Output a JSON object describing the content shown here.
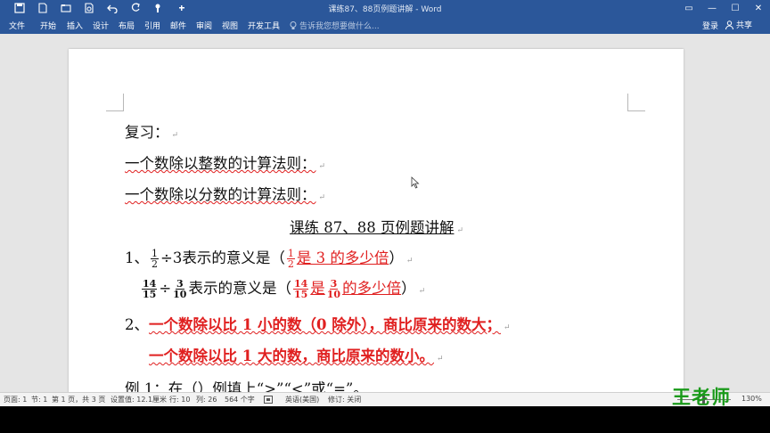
{
  "window": {
    "title": "课练87、88页例题讲解 - Word",
    "controls": {
      "restore": "▭",
      "minimize": "—",
      "maximize": "☐",
      "close": "✕"
    }
  },
  "quick_access": [
    {
      "icon": "save-icon"
    },
    {
      "icon": "new-document-icon"
    },
    {
      "icon": "open-icon"
    },
    {
      "icon": "print-preview-icon"
    },
    {
      "icon": "undo-icon"
    },
    {
      "icon": "redo-icon"
    },
    {
      "icon": "touch-mode-icon"
    },
    {
      "icon": "customize-icon"
    }
  ],
  "ribbon_tabs": [
    "文件",
    "开始",
    "插入",
    "设计",
    "布局",
    "引用",
    "邮件",
    "审阅",
    "视图",
    "开发工具"
  ],
  "tell_me": {
    "placeholder": "告诉我您想要做什么..."
  },
  "account": {
    "signin": "登录",
    "share": "共享"
  },
  "document": {
    "review_heading": "复习：",
    "rule_integer": "一个数除以整数的计算法则：",
    "rule_fraction": "一个数除以分数的计算法则：",
    "section_title": "课练 87、88 页例题讲解",
    "q1": {
      "number": "1、",
      "frac_a": {
        "num": "1",
        "den": "2"
      },
      "divide_by": "÷3",
      "meaning_label": "表示的意义是（",
      "ans_frac": {
        "num": "1",
        "den": "2"
      },
      "answer": "是 3 的多少倍",
      "close": "）"
    },
    "q1b": {
      "frac_a": {
        "num": "14",
        "den": "15"
      },
      "divide": "÷",
      "frac_b": {
        "num": "3",
        "den": "10"
      },
      "meaning_label": "表示的意义是（",
      "ans_frac_a": {
        "num": "14",
        "den": "15"
      },
      "answer_mid": "是",
      "ans_frac_b": {
        "num": "3",
        "den": "10"
      },
      "answer_end": "的多少倍",
      "close": "）"
    },
    "q2": {
      "number": "2、",
      "line1": "一个数除以比 1 小的数（0 除外），商比原来的数大；",
      "line2": "一个数除以比 1 大的数，商比原来的数小。"
    },
    "example": "例 1：在（）例填上“>”“<”或“=”。",
    "paragraph_mark": "↵"
  },
  "statusbar": {
    "page": "页面: 1",
    "section": "节: 1",
    "page_of": "第 1 页，共 3 页",
    "setting": "设置值: 12.1厘米",
    "row": "行: 10",
    "col": "列: 26",
    "chars": "564 个字",
    "language": "英语(美国)",
    "track": "修订: 关闭",
    "zoom": "130%"
  },
  "watermark": "王老师",
  "colors": {
    "ribbon": "#2b579a",
    "answer_red": "#e02020",
    "watermark_green": "#1a9a1a"
  }
}
